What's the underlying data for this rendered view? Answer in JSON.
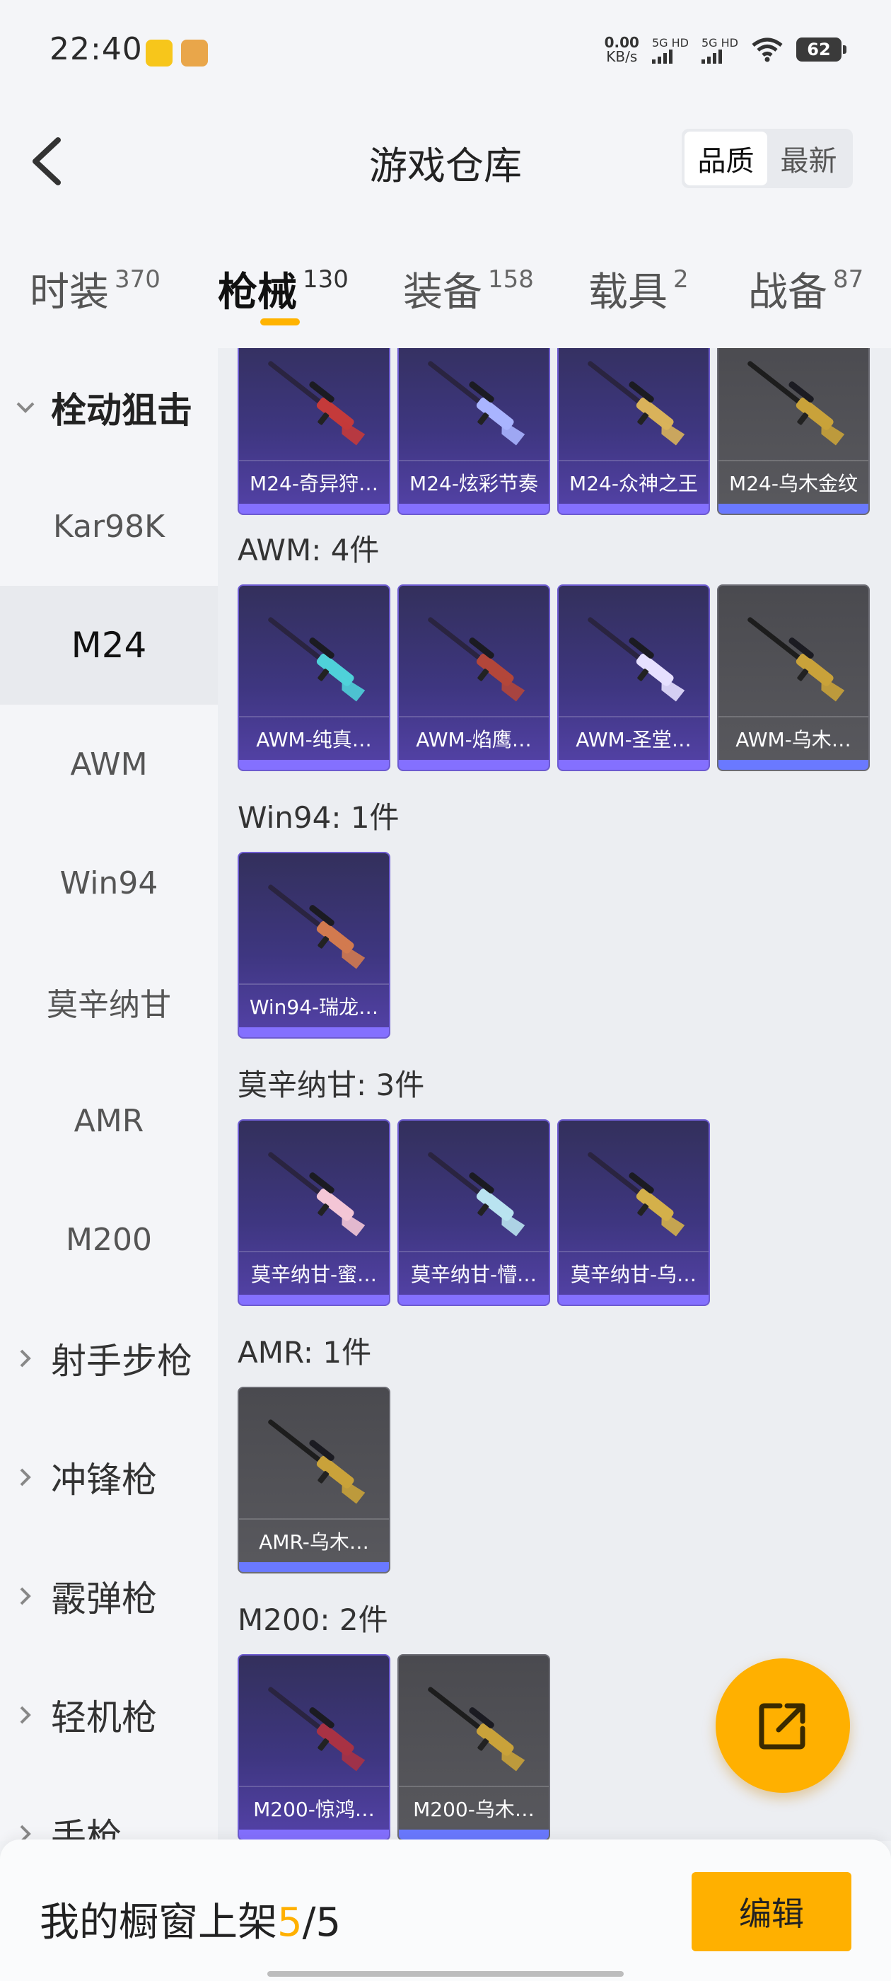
{
  "status_bar": {
    "time": "22:40",
    "net_speed_value": "0.00",
    "net_speed_unit": "KB/s",
    "sim1_label": "5G HD",
    "sim2_label": "5G HD",
    "battery": "62"
  },
  "header": {
    "title": "游戏仓库",
    "sort_options": [
      "品质",
      "最新"
    ],
    "sort_selected": "品质"
  },
  "tabs": [
    {
      "label": "时装",
      "count": "370"
    },
    {
      "label": "枪械",
      "count": "130"
    },
    {
      "label": "装备",
      "count": "158"
    },
    {
      "label": "载具",
      "count": "2"
    },
    {
      "label": "战备",
      "count": "87"
    }
  ],
  "active_tab": "枪械",
  "sidebar": {
    "group_bolt": "栓动狙击",
    "sub_items": [
      "Kar98K",
      "M24",
      "AWM",
      "Win94",
      "莫辛纳甘",
      "AMR",
      "M200"
    ],
    "active_item": "M24",
    "groups": [
      "射手步枪",
      "冲锋枪",
      "霰弹枪",
      "轻机枪",
      "手枪"
    ]
  },
  "sections": [
    {
      "title": "",
      "items": [
        {
          "label": "M24-奇异狩…",
          "tier": "purple"
        },
        {
          "label": "M24-炫彩节奏",
          "tier": "purple"
        },
        {
          "label": "M24-众神之王",
          "tier": "purple"
        },
        {
          "label": "M24-乌木金纹",
          "tier": "gold"
        }
      ]
    },
    {
      "title": "AWM: 4件",
      "items": [
        {
          "label": "AWM-纯真…",
          "tier": "purple"
        },
        {
          "label": "AWM-焰鹰…",
          "tier": "purple"
        },
        {
          "label": "AWM-圣堂…",
          "tier": "purple"
        },
        {
          "label": "AWM-乌木…",
          "tier": "gold"
        }
      ]
    },
    {
      "title": "Win94: 1件",
      "items": [
        {
          "label": "Win94-瑞龙…",
          "tier": "purple"
        }
      ]
    },
    {
      "title": "莫辛纳甘: 3件",
      "items": [
        {
          "label": "莫辛纳甘-蜜…",
          "tier": "purple"
        },
        {
          "label": "莫辛纳甘-懵…",
          "tier": "purple"
        },
        {
          "label": "莫辛纳甘-乌…",
          "tier": "purple"
        }
      ]
    },
    {
      "title": "AMR: 1件",
      "items": [
        {
          "label": "AMR-乌木…",
          "tier": "gold"
        }
      ]
    },
    {
      "title": "M200: 2件",
      "items": [
        {
          "label": "M200-惊鸿…",
          "tier": "purple"
        },
        {
          "label": "M200-乌木…",
          "tier": "gold"
        }
      ]
    }
  ],
  "bottom_bar": {
    "label": "我的橱窗上架",
    "current": "5",
    "separator": "/",
    "total": "5",
    "edit_label": "编辑"
  },
  "colors": {
    "accent": "#ffb000",
    "purple_card": "#3e3680",
    "gold_card": "#56565b"
  }
}
